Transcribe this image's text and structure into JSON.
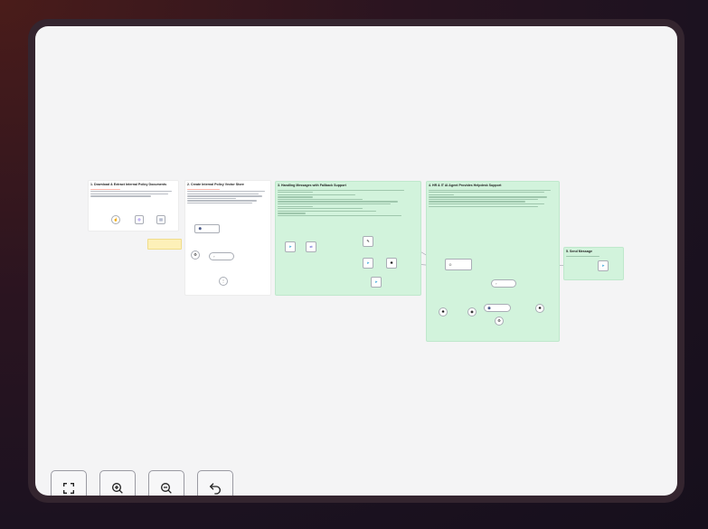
{
  "workflow": {
    "sections": [
      {
        "title": "1. Download & Extract Internal Policy Documents"
      },
      {
        "title": "2. Create Internal Policy Vector Store"
      },
      {
        "title": "3. Handling Messages with Fallback Support"
      },
      {
        "title": "4. HR & IT AI Agent Provides Helpdesk Support"
      },
      {
        "title": "5. Send Message"
      }
    ]
  },
  "controls": {
    "fit_view": "fit-to-view",
    "zoom_in": "zoom-in",
    "zoom_out": "zoom-out",
    "reset": "undo"
  },
  "colors": {
    "accent": "#ff6d5a",
    "section_green": "#d2f3dc",
    "canvas": "#f4f4f5",
    "frame": "#34252f"
  }
}
